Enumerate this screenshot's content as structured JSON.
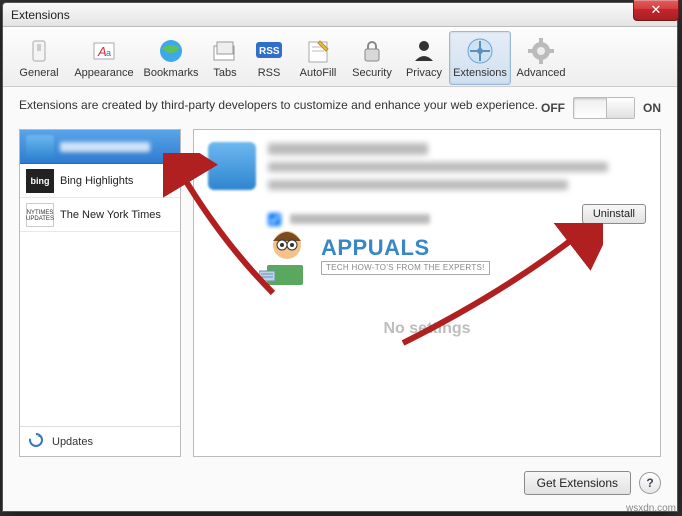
{
  "window": {
    "title": "Extensions"
  },
  "toolbar": {
    "items": [
      {
        "label": "General"
      },
      {
        "label": "Appearance"
      },
      {
        "label": "Bookmarks"
      },
      {
        "label": "Tabs"
      },
      {
        "label": "RSS"
      },
      {
        "label": "AutoFill"
      },
      {
        "label": "Security"
      },
      {
        "label": "Privacy"
      },
      {
        "label": "Extensions"
      },
      {
        "label": "Advanced"
      }
    ]
  },
  "description": "Extensions are created by third-party developers to customize and enhance your web experience.",
  "switch": {
    "off_label": "OFF",
    "on_label": "ON"
  },
  "sidebar": {
    "items": [
      {
        "label": "(selected extension)"
      },
      {
        "label": "Bing Highlights"
      },
      {
        "label": "The New York Times"
      }
    ],
    "updates_label": "Updates"
  },
  "detail": {
    "title": "(extension name)",
    "subtitle": "(extension description text – obscured in screenshot)",
    "checkbox_label": "(option – obscured)",
    "uninstall_label": "Uninstall",
    "no_settings": "No settings"
  },
  "logo": {
    "main": "APPUALS",
    "sub": "TECH HOW-TO'S FROM THE EXPERTS!"
  },
  "footer": {
    "get_extensions": "Get Extensions",
    "help": "?"
  },
  "watermark": "wsxdn.com"
}
